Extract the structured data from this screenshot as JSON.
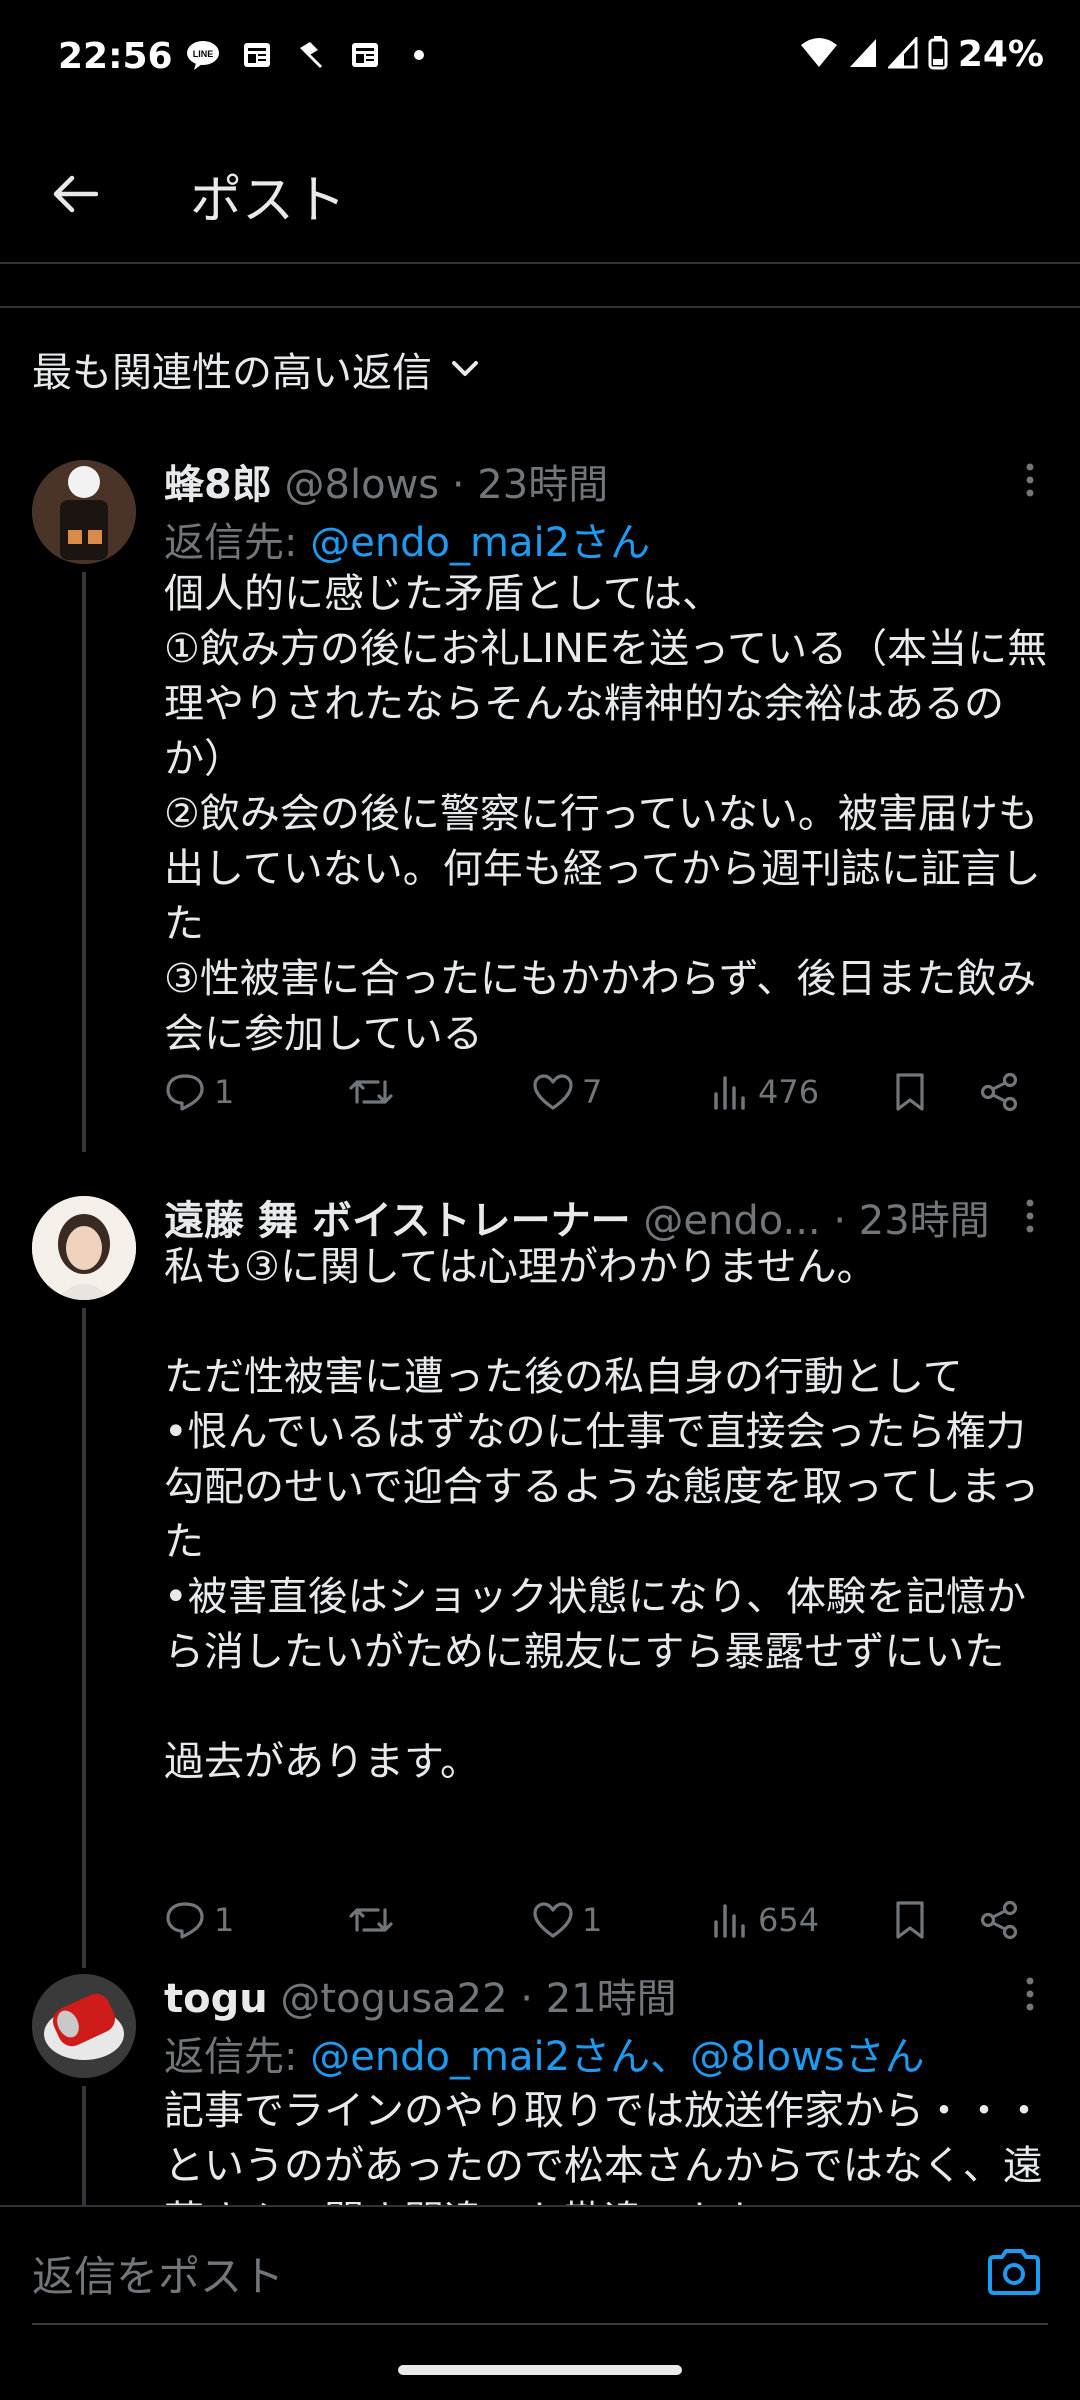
{
  "status_bar": {
    "time": "22:56",
    "battery": "24%"
  },
  "header": {
    "title": "ポスト"
  },
  "sort": {
    "label": "最も関連性の高い返信"
  },
  "composer": {
    "placeholder": "返信をポスト"
  },
  "colors": {
    "link": "#1d9bf0",
    "text": "#e7e9ea",
    "muted": "#71767b",
    "background": "#000000"
  },
  "tweets": [
    {
      "name": "蜂8郎",
      "meta": " @8lows · 23時間",
      "reply_prefix": "返信先: ",
      "reply_targets": "@endo_mai2さん",
      "body": [
        "個人的に感じた矛盾としては、",
        "①飲み方の後にお礼LINEを送っている（本当に無理やりされたならそんな精神的な余裕はあるのか）",
        "②飲み会の後に警察に行っていない。被害届けも出していない。何年も経ってから週刊誌に証言した",
        "③性被害に合ったにもかかわらず、後日また飲み会に参加している"
      ],
      "replies": "1",
      "reposts": "",
      "likes": "7",
      "views": "476"
    },
    {
      "name": "遠藤 舞 ボイストレーナー",
      "meta": " @endo... · 23時間",
      "body": [
        "私も③に関しては心理がわかりません。",
        "",
        "ただ性被害に遭った後の私自身の行動として",
        "•恨んでいるはずなのに仕事で直接会ったら権力勾配のせいで迎合するような態度を取ってしまった",
        "•被害直後はショック状態になり、体験を記憶から消したいがために親友にすら暴露せずにいた",
        "",
        "過去があります。"
      ],
      "replies": "1",
      "reposts": "",
      "likes": "1",
      "views": "654"
    },
    {
      "name": "togu",
      "meta": " @togusa22 · 21時間",
      "reply_prefix": "返信先: ",
      "reply_targets": "@endo_mai2さん、@8lowsさん",
      "body": [
        "記事でラインのやり取りでは放送作家から・・・というのがあったので松本さんからではなく、遠藤さんの聞き間違いか勘違いかも"
      ]
    }
  ]
}
